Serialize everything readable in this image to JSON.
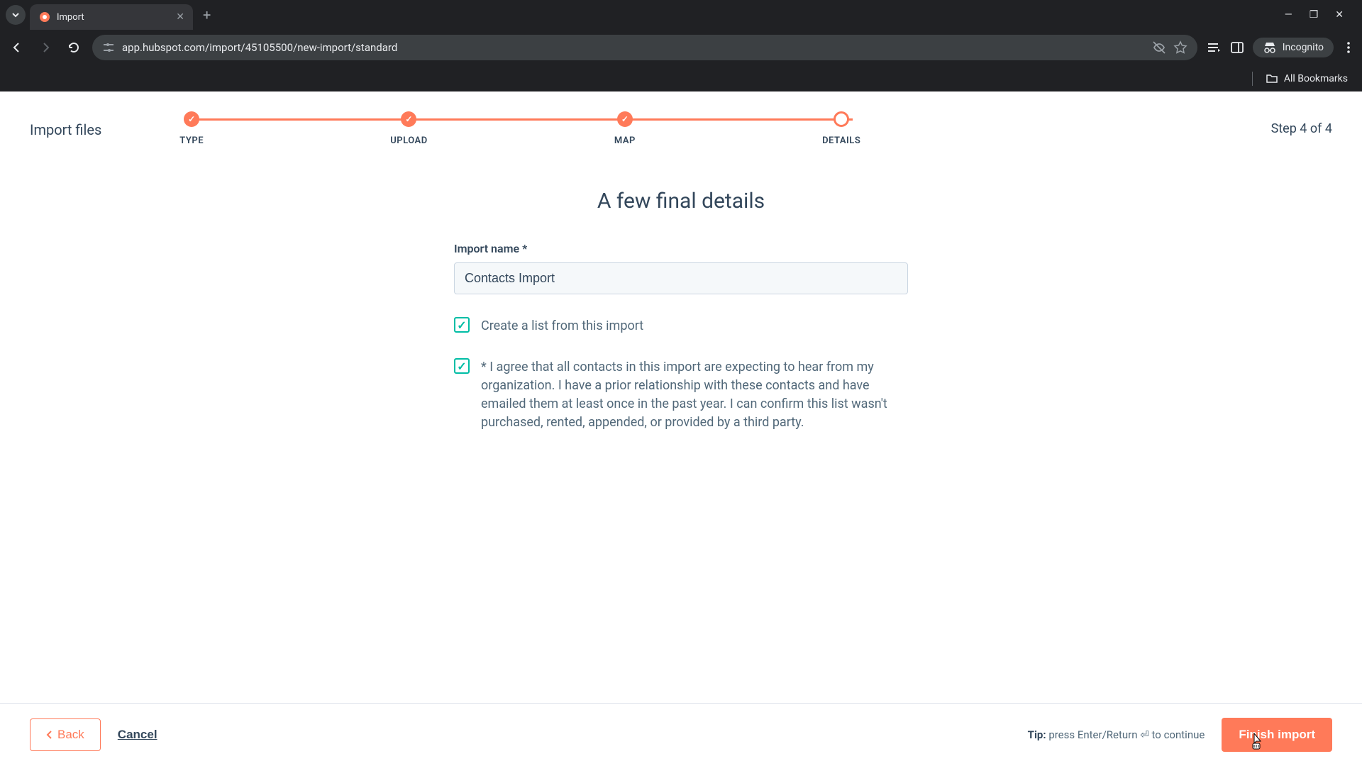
{
  "browser": {
    "tab_title": "Import",
    "url": "app.hubspot.com/import/45105500/new-import/standard",
    "incognito_label": "Incognito",
    "bookmarks_label": "All Bookmarks"
  },
  "stepper": {
    "title": "Import files",
    "step_counter": "Step 4 of 4",
    "steps": [
      {
        "label": "TYPE",
        "done": true
      },
      {
        "label": "UPLOAD",
        "done": true
      },
      {
        "label": "MAP",
        "done": true
      },
      {
        "label": "DETAILS",
        "done": false
      }
    ]
  },
  "form": {
    "heading": "A few final details",
    "name_label": "Import name *",
    "name_value": "Contacts Import",
    "create_list_label": "Create a list from this import",
    "create_list_checked": true,
    "agree_label": "* I agree that all contacts in this import are expecting to hear from my organization. I have a prior relationship with these contacts and have emailed them at least once in the past year. I can confirm this list wasn't purchased, rented, appended, or provided by a third party.",
    "agree_checked": true
  },
  "footer": {
    "back_label": "Back",
    "cancel_label": "Cancel",
    "tip_prefix": "Tip:",
    "tip_text": " press Enter/Return ⏎ to continue",
    "finish_label": "Finish import"
  },
  "colors": {
    "accent": "#ff7a59",
    "teal": "#00bda5",
    "text": "#33475b"
  }
}
